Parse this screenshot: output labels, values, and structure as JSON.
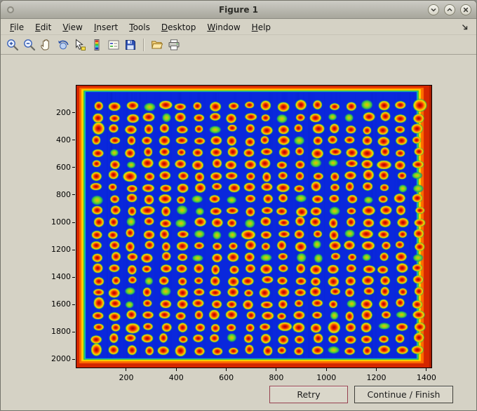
{
  "window": {
    "title": "Figure 1",
    "controls": [
      {
        "name": "minimize"
      },
      {
        "name": "maximize"
      },
      {
        "name": "close"
      }
    ]
  },
  "menubar": {
    "items": [
      {
        "label": "File"
      },
      {
        "label": "Edit"
      },
      {
        "label": "View"
      },
      {
        "label": "Insert"
      },
      {
        "label": "Tools"
      },
      {
        "label": "Desktop"
      },
      {
        "label": "Window"
      },
      {
        "label": "Help"
      }
    ]
  },
  "toolbar": {
    "buttons": [
      {
        "name": "zoom-in",
        "group": 1
      },
      {
        "name": "zoom-out",
        "group": 1
      },
      {
        "name": "pan",
        "group": 1
      },
      {
        "name": "rotate-3d",
        "group": 1
      },
      {
        "name": "data-cursor",
        "group": 1
      },
      {
        "name": "insert-colorbar",
        "group": 1
      },
      {
        "name": "insert-legend",
        "group": 1
      },
      {
        "name": "save",
        "group": 1
      },
      {
        "name": "open-folder",
        "group": 2
      },
      {
        "name": "print",
        "group": 2
      }
    ]
  },
  "figure": {
    "buttons": [
      {
        "name": "retry",
        "label": "Retry"
      },
      {
        "name": "continue-finish",
        "label": "Continue / Finish"
      }
    ]
  },
  "chart_data": {
    "type": "heatmap",
    "title": "",
    "xlabel": "",
    "ylabel": "",
    "xlim": [
      1,
      1420
    ],
    "ylim": [
      1,
      2060
    ],
    "x_ticks": [
      200,
      400,
      600,
      800,
      1000,
      1200,
      1400
    ],
    "y_ticks": [
      200,
      400,
      600,
      800,
      1000,
      1200,
      1400,
      1600,
      1800,
      2000
    ],
    "colormap": "jet",
    "content": "microarray plate scan: cool blue field, hot red/orange border bands with yellow-green transition rings, regular grid of hot spots",
    "spot_grid": {
      "rows": 22,
      "cols": 20,
      "x_start": 85,
      "x_step": 67.5,
      "y_start": 150,
      "y_step": 85,
      "spot_radius_x": 16,
      "spot_radius_y": 24,
      "weak_spot_fraction": 0.1
    },
    "colors": {
      "field_blue": "#0a28dc",
      "edge_red": "#d42600",
      "edge_orange": "#ff6a00",
      "edge_yellow": "#ffd300",
      "edge_green": "#2ec82e",
      "edge_cyan": "#18b8c8",
      "spot_core": "#a00000",
      "spot_hot": "#ee2200",
      "spot_warm": "#ff9900",
      "spot_rim": "#ffe000",
      "spot_halo": "#33cc33"
    }
  }
}
